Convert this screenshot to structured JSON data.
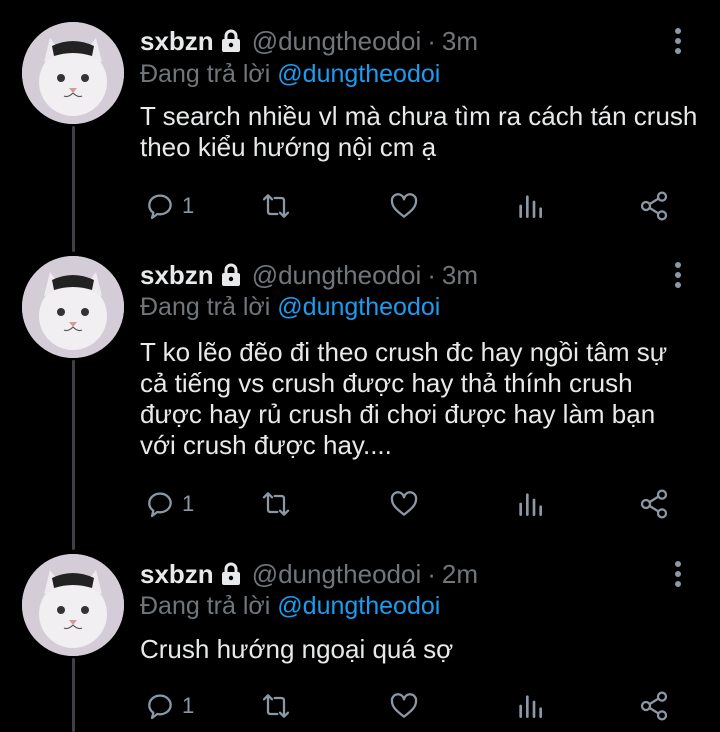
{
  "tweets": [
    {
      "display_name": "sxbzn",
      "handle": "@dungtheodoi",
      "dot": "·",
      "time": "3m",
      "replying_prefix": "Đang trả lời",
      "replying_to": "@dungtheodoi",
      "text": "T search nhiều vl mà chưa tìm ra cách tán crush theo kiểu hướng nội cm ạ",
      "reply_count": "1",
      "icons": [
        "avatar-cat",
        "lock-icon",
        "more-icon",
        "reply-icon",
        "retweet-icon",
        "like-icon",
        "analytics-icon",
        "share-icon"
      ]
    },
    {
      "display_name": "sxbzn",
      "handle": "@dungtheodoi",
      "dot": "·",
      "time": "3m",
      "replying_prefix": "Đang trả lời",
      "replying_to": "@dungtheodoi",
      "text": "T ko lẽo đẽo đi theo crush đc hay ngồi tâm sự cả tiếng vs crush được hay thả thính crush được hay rủ crush đi chơi được hay làm bạn với crush được hay....",
      "reply_count": "1",
      "icons": [
        "avatar-cat",
        "lock-icon",
        "more-icon",
        "reply-icon",
        "retweet-icon",
        "like-icon",
        "analytics-icon",
        "share-icon"
      ]
    },
    {
      "display_name": "sxbzn",
      "handle": "@dungtheodoi",
      "dot": "·",
      "time": "2m",
      "replying_prefix": "Đang trả lời",
      "replying_to": "@dungtheodoi",
      "text": "Crush hướng ngoại quá sợ",
      "reply_count": "1",
      "icons": [
        "avatar-cat",
        "lock-icon",
        "more-icon",
        "reply-icon",
        "retweet-icon",
        "like-icon",
        "analytics-icon",
        "share-icon"
      ]
    }
  ],
  "colors": {
    "background": "#000000",
    "text": "#e7e9ea",
    "muted": "#71767b",
    "link": "#1d9bf0",
    "icon": "#8b98a5",
    "thread_line": "#3d4145"
  }
}
